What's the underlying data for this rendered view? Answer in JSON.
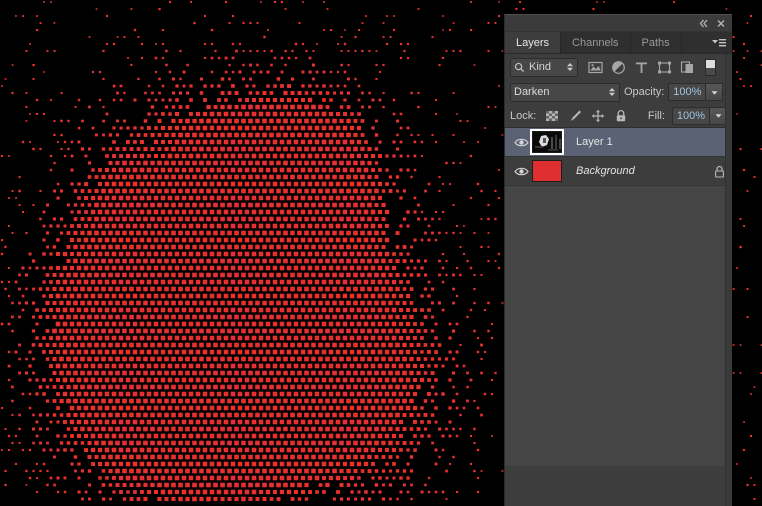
{
  "window": {
    "title": "Layers",
    "collapse_icon": "collapse-to-icons-icon",
    "close_icon": "close-icon"
  },
  "panel": {
    "tabs": [
      {
        "label": "Layers",
        "active": true
      },
      {
        "label": "Channels",
        "active": false
      },
      {
        "label": "Paths",
        "active": false
      }
    ],
    "menu_icon": "panel-menu-icon",
    "filter": {
      "search_icon": "search-icon",
      "kind_label": "Kind",
      "stepper_icon": "up-down-arrows-icon",
      "icons": [
        "pixel-layer-filter-icon",
        "adjustment-layer-filter-icon",
        "type-layer-filter-icon",
        "shape-layer-filter-icon",
        "smart-object-filter-icon"
      ],
      "toggle_icon": "filter-enable-toggle-icon"
    },
    "blend": {
      "mode": "Darken",
      "mode_stepper_icon": "up-down-arrows-icon",
      "opacity_label": "Opacity:",
      "opacity_value": "100%",
      "opacity_arrow_icon": "chevron-down-icon"
    },
    "lock": {
      "label": "Lock:",
      "icons": [
        "lock-transparent-pixels-icon",
        "lock-image-pixels-icon",
        "lock-position-icon",
        "lock-all-icon"
      ],
      "fill_label": "Fill:",
      "fill_value": "100%",
      "fill_arrow_icon": "chevron-down-icon"
    },
    "layers": [
      {
        "name": "Layer 1",
        "visible": true,
        "selected": true,
        "italic": false,
        "locked": false,
        "thumbnail": "image-thumbnail",
        "eye_icon": "eye-icon"
      },
      {
        "name": "Background",
        "visible": true,
        "selected": false,
        "italic": true,
        "locked": true,
        "thumbnail": "solid-red-thumbnail",
        "thumbnail_color": "#df2f30",
        "eye_icon": "eye-icon",
        "lock_icon": "lock-icon"
      }
    ]
  },
  "canvas": {
    "background_color": "#000000",
    "dot_color": "#e8312f",
    "description": "halftone-portrait"
  },
  "colors": {
    "panel_bg": "#3d3d3d",
    "panel_dark": "#2f2f2f",
    "selection": "#5a6274",
    "value_text": "#9fc4e0",
    "red": "#df2f30"
  }
}
